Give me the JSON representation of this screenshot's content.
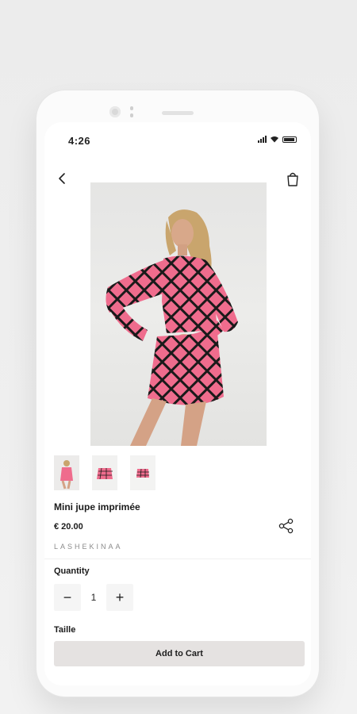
{
  "status_bar": {
    "time": "4:26"
  },
  "nav": {
    "back_icon": "chevron-left-icon",
    "cart_icon": "shopping-bag-icon"
  },
  "product": {
    "image": {
      "description_icon": "product-photo"
    },
    "thumbnails": [
      "thumbnail-1",
      "thumbnail-2",
      "thumbnail-3"
    ],
    "title": "Mini jupe imprimée",
    "price": "€ 20.00",
    "brand": "LASHEKINAA"
  },
  "quantity": {
    "label": "Quantity",
    "value": "1",
    "minus": "−",
    "plus": "+"
  },
  "size": {
    "label": "Taille"
  },
  "cta": {
    "label": "Add to Cart"
  },
  "colors": {
    "pattern_pink": "#ef6c8d",
    "pattern_dark": "#1a1a1a",
    "button_bg": "#e5e2e1"
  }
}
